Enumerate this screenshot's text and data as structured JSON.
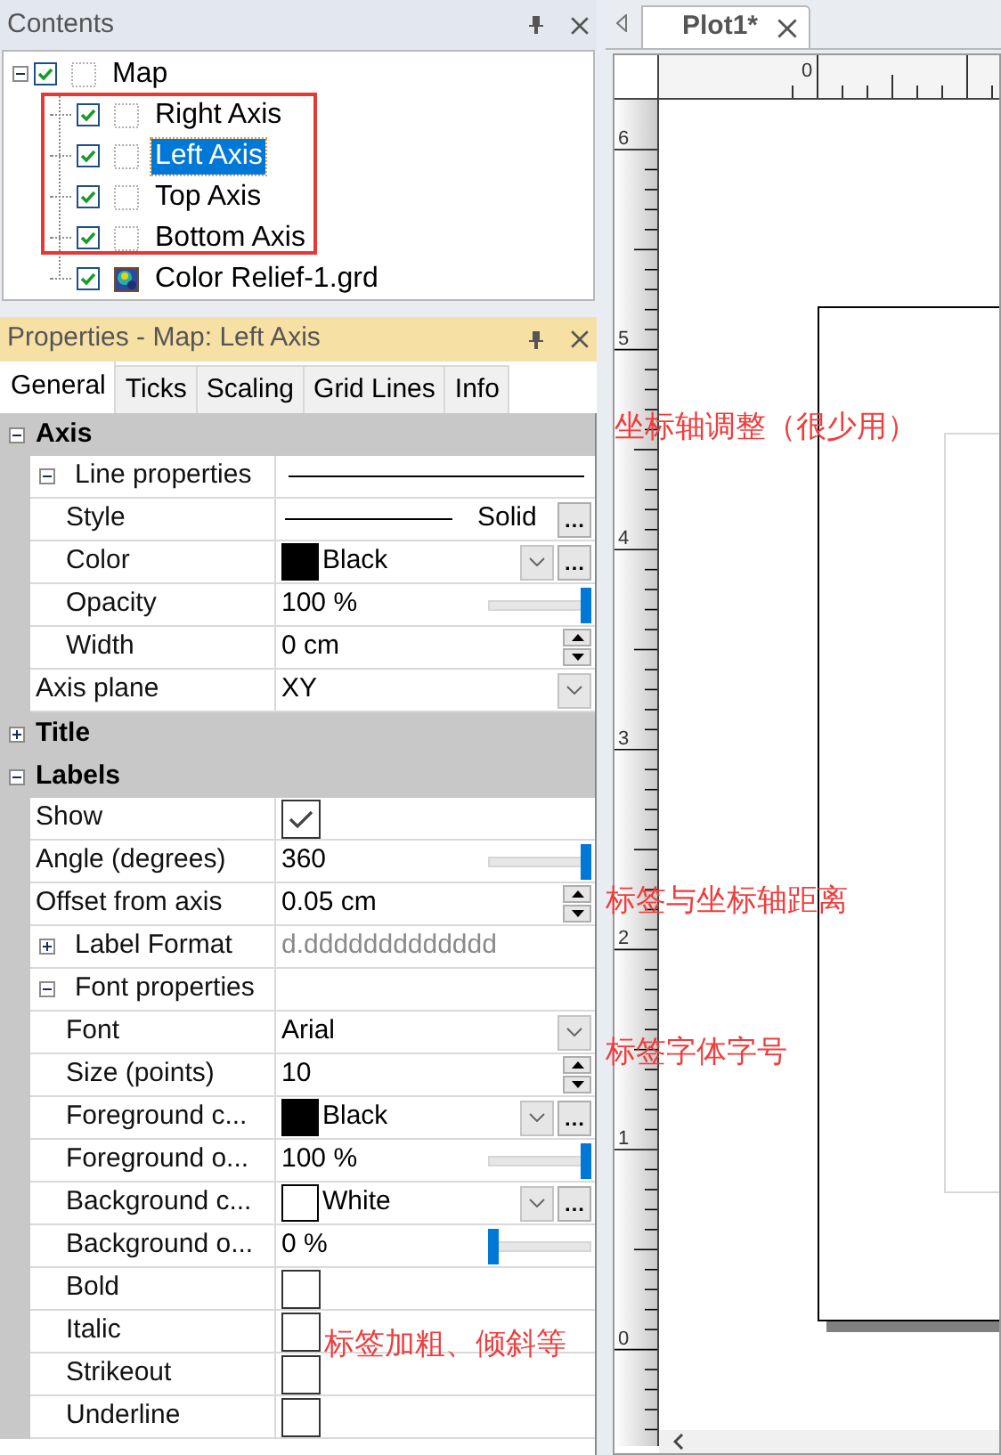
{
  "contents_panel": {
    "title": "Contents",
    "tree": [
      {
        "label": "Map",
        "checked": true,
        "selected": false,
        "expanded": true,
        "kind": "layer",
        "children": [
          {
            "label": "Right Axis",
            "checked": true,
            "selected": false,
            "kind": "layer"
          },
          {
            "label": "Left Axis",
            "checked": true,
            "selected": true,
            "kind": "layer"
          },
          {
            "label": "Top Axis",
            "checked": true,
            "selected": false,
            "kind": "layer"
          },
          {
            "label": "Bottom Axis",
            "checked": true,
            "selected": false,
            "kind": "layer"
          },
          {
            "label": "Color Relief-1.grd",
            "checked": true,
            "selected": false,
            "kind": "grid"
          }
        ]
      }
    ]
  },
  "properties_panel": {
    "title": "Properties - Map: Left Axis",
    "tabs": [
      {
        "label": "General",
        "selected": true
      },
      {
        "label": "Ticks",
        "selected": false
      },
      {
        "label": "Scaling",
        "selected": false
      },
      {
        "label": "Grid Lines",
        "selected": false
      },
      {
        "label": "Info",
        "selected": false
      }
    ],
    "sections": [
      {
        "label": "Axis",
        "expanded": true,
        "rows": [
          {
            "kind": "line_group",
            "label": "Line properties",
            "expanded": true,
            "children": [
              {
                "kind": "style",
                "label": "Style",
                "value": "Solid",
                "more_button": "…"
              },
              {
                "kind": "color",
                "label": "Color",
                "value": "Black",
                "color": "#000000",
                "more_button": "…"
              },
              {
                "kind": "slider",
                "label": "Opacity",
                "value": "100 %",
                "level": 1
              },
              {
                "kind": "spin",
                "label": "Width",
                "value": "0 cm"
              }
            ]
          },
          {
            "kind": "dropdown",
            "label": "Axis plane",
            "value": "XY"
          }
        ]
      },
      {
        "label": "Title",
        "expanded": false
      },
      {
        "label": "Labels",
        "expanded": true,
        "rows": [
          {
            "kind": "checkbox",
            "label": "Show",
            "checked": true
          },
          {
            "kind": "slider",
            "label": "Angle (degrees)",
            "value": "360",
            "level": 1
          },
          {
            "kind": "spin",
            "label": "Offset from axis",
            "value": "0.05 cm"
          },
          {
            "kind": "group",
            "label": "Label Format",
            "expanded": false,
            "value": "d.ddddddddddddd",
            "children": []
          },
          {
            "kind": "group",
            "label": "Font properties",
            "expanded": true,
            "children": [
              {
                "kind": "dropdown",
                "label": "Font",
                "value": "Arial"
              },
              {
                "kind": "spin",
                "label": "Size (points)",
                "value": "10"
              },
              {
                "kind": "color",
                "label": "Foreground c...",
                "value": "Black",
                "color": "#000000",
                "more_button": "…"
              },
              {
                "kind": "slider",
                "label": "Foreground o...",
                "value": "100 %",
                "level": 1
              },
              {
                "kind": "color",
                "label": "Background c...",
                "value": "White",
                "color": "#ffffff",
                "more_button": "…"
              },
              {
                "kind": "slider",
                "label": "Background o...",
                "value": "0 %",
                "level": 0
              },
              {
                "kind": "checkbox",
                "label": "Bold",
                "checked": false
              },
              {
                "kind": "checkbox",
                "label": "Italic",
                "checked": false
              },
              {
                "kind": "checkbox",
                "label": "Strikeout",
                "checked": false
              },
              {
                "kind": "checkbox",
                "label": "Underline",
                "checked": false
              }
            ]
          }
        ]
      }
    ]
  },
  "document": {
    "tabs": [
      {
        "label": "Plot1*",
        "selected": true
      }
    ],
    "ruler_top_labels": [
      "0"
    ],
    "ruler_left_labels": [
      "6",
      "5",
      "4",
      "3",
      "2",
      "1",
      "0"
    ]
  },
  "annotations": [
    {
      "text": "坐标轴调整（很少用）"
    },
    {
      "text": "标签与坐标轴距离"
    },
    {
      "text": "标签字体字号"
    },
    {
      "text": "标签加粗、倾斜等"
    }
  ]
}
